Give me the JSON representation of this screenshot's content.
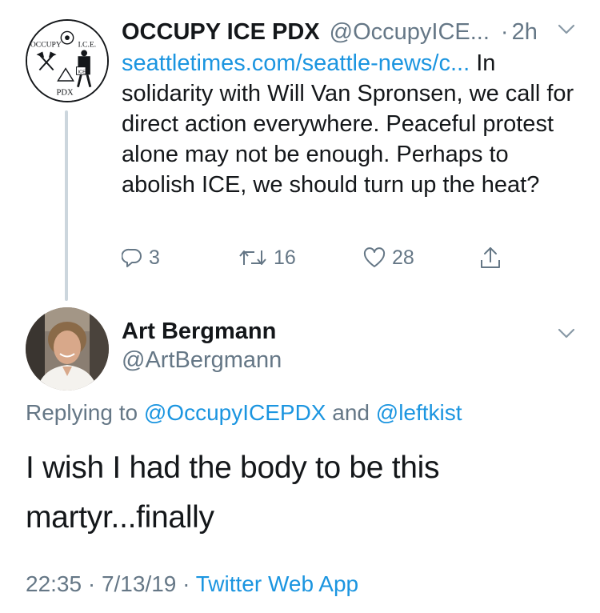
{
  "parent_tweet": {
    "avatar": {
      "logo_texts": [
        "OCCUPY",
        "I.C.E.",
        "PDX",
        "ICE"
      ]
    },
    "display_name": "OCCUPY ICE PDX",
    "handle": "@OccupyICE...",
    "separator": "·",
    "time": "2h",
    "link_text": "seattletimes.com/seattle-news/c...",
    "body_text": " In solidarity with Will Van Spronsen, we call for direct action everywhere. Peaceful protest alone may not be enough. Perhaps to abolish ICE, we should turn up the heat?",
    "actions": {
      "reply_count": "3",
      "retweet_count": "16",
      "like_count": "28"
    }
  },
  "reply_tweet": {
    "display_name": "Art Bergmann",
    "handle": "@ArtBergmann",
    "replying_prefix": "Replying to ",
    "replying_mention_1": "@OccupyICEPDX",
    "replying_and": " and ",
    "replying_mention_2": "@leftkist",
    "body_text": "I wish I had the body to be this martyr...finally",
    "timestamp": "22:35 · 7/13/19 · ",
    "source": "Twitter Web App"
  },
  "colors": {
    "link": "#1b95e0",
    "secondary_text": "#657786",
    "primary_text": "#14171a",
    "thread_line": "#ccd6dd"
  },
  "icons": {
    "reply": "reply-icon",
    "retweet": "retweet-icon",
    "like": "heart-icon",
    "share": "share-icon",
    "menu": "chevron-down-icon"
  }
}
